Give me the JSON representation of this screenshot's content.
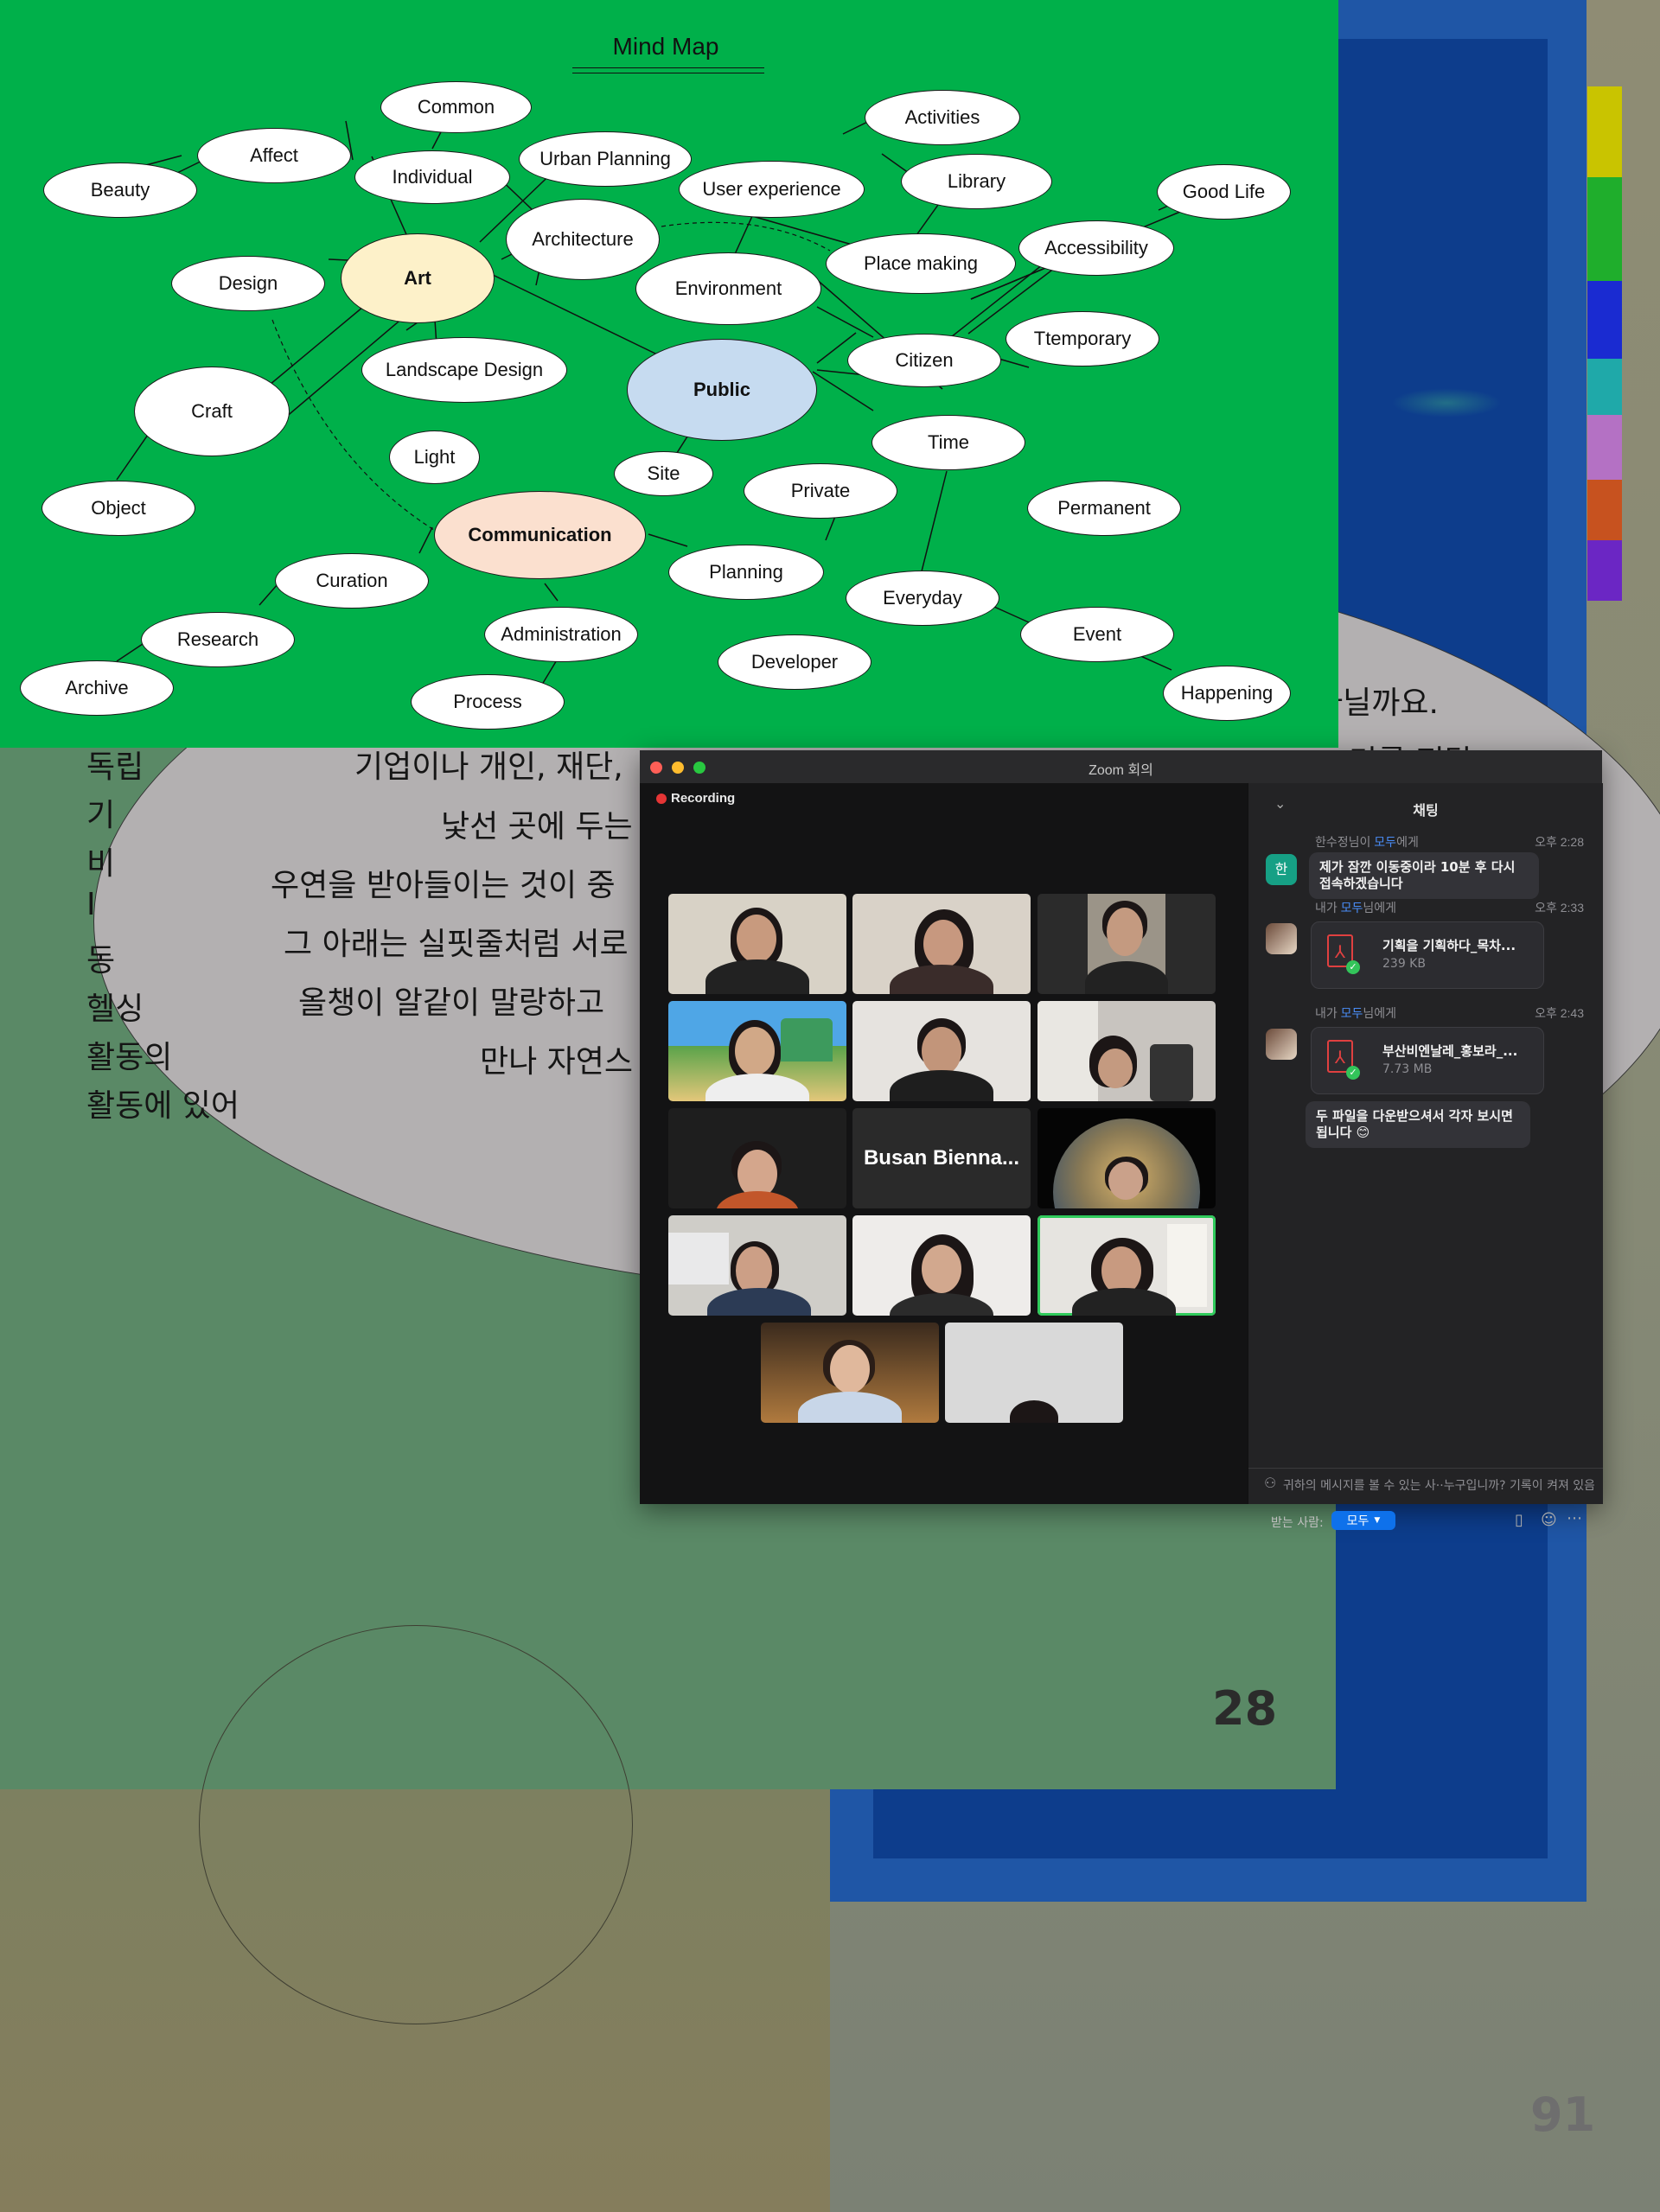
{
  "mind_map": {
    "title": "Mind Map",
    "nodes": {
      "common": "Common",
      "affect": "Affect",
      "beauty": "Beauty",
      "individual": "Individual",
      "urban_planning": "Urban Planning",
      "architecture": "Architecture",
      "activities": "Activities",
      "user_experience": "User experience",
      "library": "Library",
      "good_life": "Good Life",
      "design": "Design",
      "art": "Art",
      "environment": "Environment",
      "place_making": "Place making",
      "accessibility": "Accessibility",
      "craft": "Craft",
      "landscape_design": "Landscape Design",
      "public": "Public",
      "citizen": "Citizen",
      "ttemporary": "Ttemporary",
      "light": "Light",
      "site": "Site",
      "private": "Private",
      "time": "Time",
      "object": "Object",
      "communication": "Communication",
      "permanent": "Permanent",
      "curation": "Curation",
      "planning": "Planning",
      "everyday": "Everyday",
      "research": "Research",
      "administration": "Administration",
      "event": "Event",
      "archive": "Archive",
      "developer": "Developer",
      "process": "Process",
      "happening": "Happening"
    },
    "colors": {
      "background": "#00b04a",
      "art": "#fdf1c9",
      "public": "#c6dbf0",
      "communication": "#fbe0cf"
    }
  },
  "background_page": {
    "lines": [
      "기업이나 개인, 재단,",
      "낯선 곳에 두는",
      "우연을 받아들이는 것이 중",
      "그 아래는 실핏줄처럼 서로",
      "올챙이 알같이 말랑하고",
      "만나 자연스"
    ],
    "left_fragments": [
      "독립",
      "기",
      "비",
      "I",
      "동",
      "헬싱",
      "활동의",
      "활동에 있어"
    ],
    "right_fragment": "아닐까요.",
    "right_fragment_2": "미를 전달",
    "page_number": "28",
    "page_number_right": "91"
  },
  "zoom": {
    "window_title": "Zoom 회의",
    "recording_label": "Recording",
    "tile_name": "Busan Bienna...",
    "chat": {
      "title": "채팅",
      "messages": [
        {
          "sender": "한수정님이",
          "to": "모두",
          "suffix": "에게",
          "time": "오후 2:28",
          "avatar": "한",
          "text": "제가 잠깐 이동중이라 10분 후 다시 접속하겠습니다"
        },
        {
          "sender": "내가",
          "to": "모두",
          "suffix": "님에게",
          "time": "오후 2:33",
          "file_name": "기획을 기획하다_목차...",
          "file_size": "239 KB"
        },
        {
          "sender": "내가",
          "to": "모두",
          "suffix": "님에게",
          "time": "오후 2:43",
          "file_name": "부산비엔날레_홍보라_...",
          "file_size": "7.73 MB",
          "text": "두 파일을 다운받으셔서 각자 보시면 됩니다 😊"
        }
      ],
      "notice": "귀하의 메시지를 볼 수 있는 사··누구입니까? 기록이 켜져 있음",
      "to_label": "받는 사람:",
      "to_value": "모두"
    }
  }
}
